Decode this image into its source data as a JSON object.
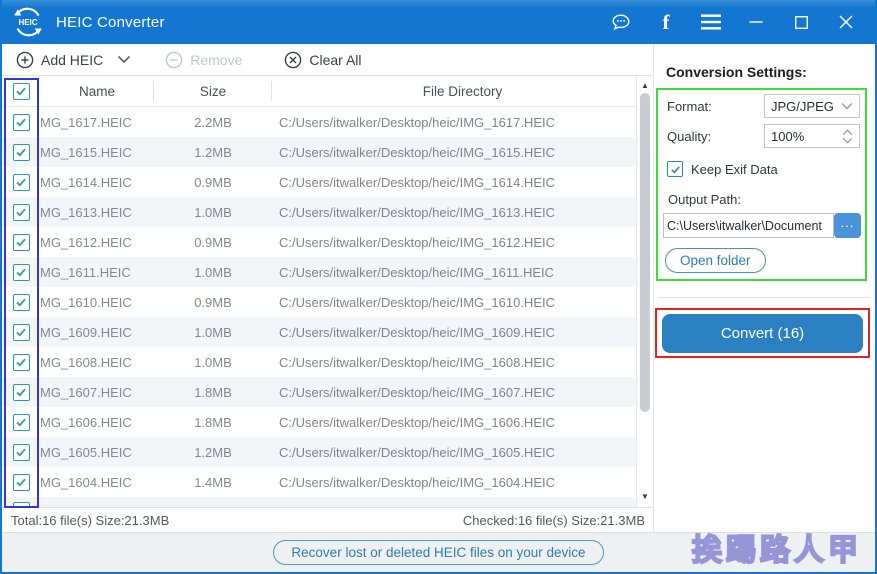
{
  "titlebar": {
    "title": "HEIC Converter",
    "logo_text": "HEIC",
    "icons": [
      "message",
      "facebook",
      "menu",
      "minimize",
      "maximize",
      "close"
    ]
  },
  "toolbar": {
    "add_label": "Add HEIC",
    "remove_label": "Remove",
    "clear_label": "Clear All"
  },
  "table": {
    "headers": {
      "name": "Name",
      "size": "Size",
      "directory": "File Directory"
    },
    "all_checked": true,
    "rows": [
      {
        "name": "MG_1617.HEIC",
        "size": "2.2MB",
        "directory": "C:/Users/itwalker/Desktop/heic/IMG_1617.HEIC",
        "checked": true
      },
      {
        "name": "MG_1615.HEIC",
        "size": "1.2MB",
        "directory": "C:/Users/itwalker/Desktop/heic/IMG_1615.HEIC",
        "checked": true
      },
      {
        "name": "MG_1614.HEIC",
        "size": "0.9MB",
        "directory": "C:/Users/itwalker/Desktop/heic/IMG_1614.HEIC",
        "checked": true
      },
      {
        "name": "MG_1613.HEIC",
        "size": "1.0MB",
        "directory": "C:/Users/itwalker/Desktop/heic/IMG_1613.HEIC",
        "checked": true
      },
      {
        "name": "MG_1612.HEIC",
        "size": "0.9MB",
        "directory": "C:/Users/itwalker/Desktop/heic/IMG_1612.HEIC",
        "checked": true
      },
      {
        "name": "MG_1611.HEIC",
        "size": "1.0MB",
        "directory": "C:/Users/itwalker/Desktop/heic/IMG_1611.HEIC",
        "checked": true
      },
      {
        "name": "MG_1610.HEIC",
        "size": "0.9MB",
        "directory": "C:/Users/itwalker/Desktop/heic/IMG_1610.HEIC",
        "checked": true
      },
      {
        "name": "MG_1609.HEIC",
        "size": "1.0MB",
        "directory": "C:/Users/itwalker/Desktop/heic/IMG_1609.HEIC",
        "checked": true
      },
      {
        "name": "MG_1608.HEIC",
        "size": "1.0MB",
        "directory": "C:/Users/itwalker/Desktop/heic/IMG_1608.HEIC",
        "checked": true
      },
      {
        "name": "MG_1607.HEIC",
        "size": "1.8MB",
        "directory": "C:/Users/itwalker/Desktop/heic/IMG_1607.HEIC",
        "checked": true
      },
      {
        "name": "MG_1606.HEIC",
        "size": "1.8MB",
        "directory": "C:/Users/itwalker/Desktop/heic/IMG_1606.HEIC",
        "checked": true
      },
      {
        "name": "MG_1605.HEIC",
        "size": "1.2MB",
        "directory": "C:/Users/itwalker/Desktop/heic/IMG_1605.HEIC",
        "checked": true
      },
      {
        "name": "MG_1604.HEIC",
        "size": "1.4MB",
        "directory": "C:/Users/itwalker/Desktop/heic/IMG_1604.HEIC",
        "checked": true
      }
    ]
  },
  "status": {
    "total": "Total:16 file(s) Size:21.3MB",
    "checked": "Checked:16 file(s) Size:21.3MB"
  },
  "settings": {
    "heading": "Conversion Settings:",
    "format_label": "Format:",
    "format_value": "JPG/JPEG",
    "quality_label": "Quality:",
    "quality_value": "100%",
    "keep_exif_label": "Keep Exif Data",
    "keep_exif_checked": true,
    "output_path_label": "Output Path:",
    "output_path_value": "C:\\Users\\itwalker\\Document",
    "browse_label": "...",
    "open_folder_label": "Open folder",
    "convert_label": "Convert (16)"
  },
  "footer": {
    "recover_label": "Recover lost or deleted HEIC files on your device"
  },
  "watermark": "挨踢路人甲",
  "colors": {
    "titlebar_blue": "#1377d1",
    "convert_blue": "#2b80c2",
    "browse_blue": "#4a93d8",
    "check_teal": "#2e9e94",
    "check_blue": "#2e80d0",
    "row_alt": "#f2f6f9",
    "annotation_blue": "#3434d8",
    "annotation_green": "#3ddc3d",
    "annotation_red": "#e22222",
    "watermark_purple": "#9595d8"
  }
}
